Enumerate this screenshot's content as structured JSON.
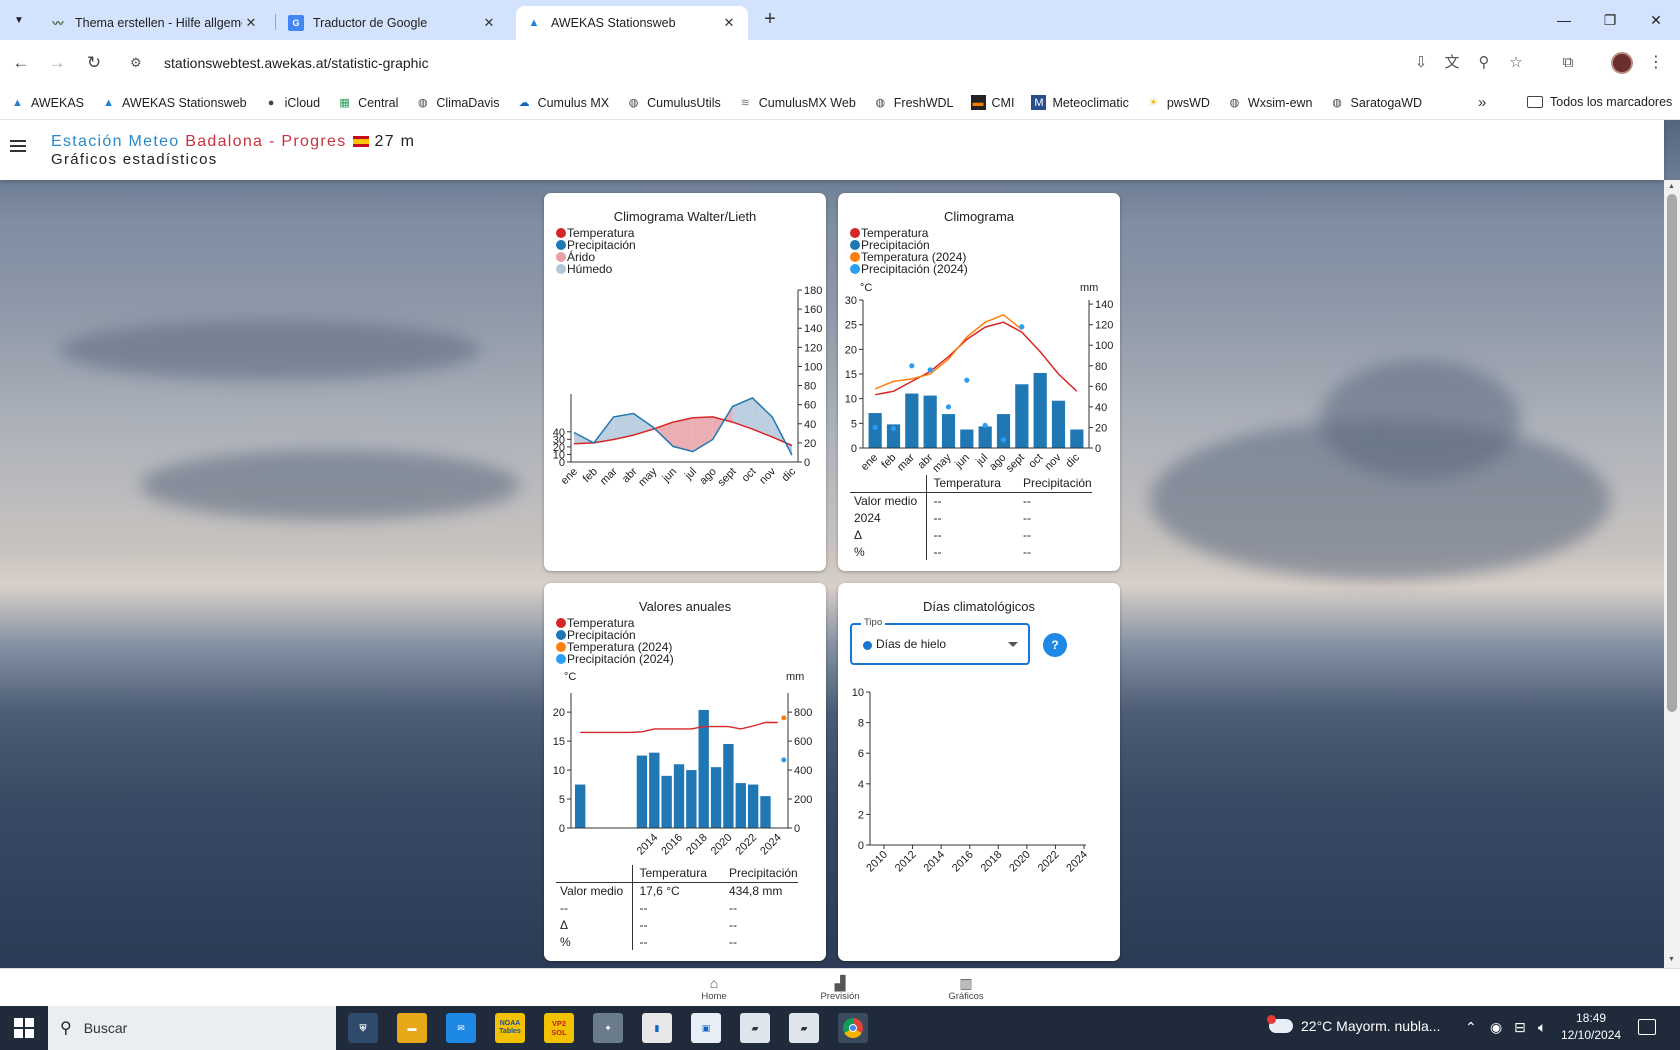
{
  "browser": {
    "tabs": [
      {
        "title": "Thema erstellen - Hilfe allgeme",
        "icon": "wxforum-icon",
        "active": false
      },
      {
        "title": "Traductor de Google",
        "icon": "google-translate-icon",
        "active": false
      },
      {
        "title": "AWEKAS Stationsweb",
        "icon": "awekas-icon",
        "active": true
      }
    ],
    "url": "stationswebtest.awekas.at/statistic-graphic",
    "bookmarks": [
      "AWEKAS",
      "AWEKAS Stationsweb",
      "iCloud",
      "Central",
      "ClimaDavis",
      "Cumulus MX",
      "CumulusUtils",
      "CumulusMX Web",
      "FreshWDL",
      "CMI",
      "Meteoclimatic",
      "pwsWD",
      "Wxsim-ewn",
      "SaratogaWD"
    ],
    "all_bookmarks": "Todos los marcadores",
    "overflow": "»"
  },
  "header": {
    "title_part1": "Estación Meteo",
    "title_part2": "Badalona - Progres",
    "altitude": "27 m",
    "subtitle": "Gráficos estadísticos"
  },
  "colors": {
    "temperature": "#d62728",
    "precipitation": "#1f77b4",
    "temperature_year": "#ff7f0e",
    "precipitation_year": "#2a9df4",
    "arid": "#e8a0a4",
    "humid": "#b0c8dc"
  },
  "walter": {
    "title": "Climograma Walter/Lieth",
    "legend": [
      "Temperatura",
      "Precipitación",
      "Árido",
      "Húmedo"
    ]
  },
  "climograma": {
    "title": "Climograma",
    "legend": [
      "Temperatura",
      "Precipitación",
      "Temperatura (2024)",
      "Precipitación (2024)"
    ],
    "y_left_unit": "°C",
    "y_right_unit": "mm",
    "table": {
      "headers": [
        "",
        "Temperatura",
        "Precipitación"
      ],
      "rows": [
        [
          "Valor medio",
          "--",
          "--"
        ],
        [
          "2024",
          "--",
          "--"
        ],
        [
          "Δ",
          "--",
          "--"
        ],
        [
          "%",
          "--",
          "--"
        ]
      ]
    }
  },
  "anuales": {
    "title": "Valores anuales",
    "legend": [
      "Temperatura",
      "Precipitación",
      "Temperatura (2024)",
      "Precipitación (2024)"
    ],
    "y_left_unit": "°C",
    "y_right_unit": "mm",
    "table": {
      "headers": [
        "",
        "Temperatura",
        "Precipitación"
      ],
      "rows": [
        [
          "Valor medio",
          "17,6 °C",
          "434,8 mm"
        ],
        [
          "--",
          "--",
          "--"
        ],
        [
          "Δ",
          "--",
          "--"
        ],
        [
          "%",
          "--",
          "--"
        ]
      ]
    }
  },
  "dias": {
    "title": "Días climatológicos",
    "select_label": "Tipo",
    "select_value": "Días de hielo",
    "help": "?"
  },
  "chart_data": [
    {
      "type": "area",
      "name": "walter",
      "categories": [
        "ene",
        "feb",
        "mar",
        "abr",
        "may",
        "jun",
        "jul",
        "ago",
        "sept",
        "oct",
        "nov",
        "dic"
      ],
      "y_left_ticks": [
        0,
        10,
        20,
        30,
        40
      ],
      "y_right_ticks": [
        0,
        20,
        40,
        60,
        80,
        100,
        120,
        140,
        160,
        180
      ],
      "y_left_range": [
        0,
        90
      ],
      "y_right_range": [
        0,
        180
      ],
      "series": [
        {
          "name": "Temperatura",
          "axis": "left",
          "values": [
            10.5,
            11,
            13,
            15.5,
            19,
            23,
            25.5,
            26,
            23,
            19,
            14.5,
            9.5
          ]
        },
        {
          "name": "Precipitación",
          "axis": "right",
          "values": [
            34,
            22,
            52,
            56,
            40,
            18,
            12,
            26,
            64,
            74,
            52,
            8
          ]
        }
      ]
    },
    {
      "type": "bar",
      "name": "climograma",
      "categories": [
        "ene",
        "feb",
        "mar",
        "abr",
        "may",
        "jun",
        "jul",
        "ago",
        "sept",
        "oct",
        "nov",
        "dic"
      ],
      "y_left_ticks": [
        0,
        5,
        10,
        15,
        20,
        25,
        30
      ],
      "y_right_ticks": [
        0,
        20,
        40,
        60,
        80,
        100,
        120,
        140
      ],
      "y_left_range": [
        0,
        30
      ],
      "y_right_range": [
        0,
        144
      ],
      "series": [
        {
          "name": "Temperatura",
          "type": "line",
          "axis": "left",
          "values": [
            10.8,
            11.5,
            13.5,
            15.5,
            18.5,
            22,
            24.5,
            25.5,
            23.5,
            19.5,
            15,
            11.5
          ]
        },
        {
          "name": "Precipitación",
          "type": "bar",
          "axis": "right",
          "values": [
            34,
            23,
            53,
            51,
            33,
            18,
            21,
            33,
            62,
            73,
            46,
            18
          ]
        },
        {
          "name": "Temperatura (2024)",
          "type": "line",
          "axis": "left",
          "values": [
            12,
            13.5,
            14,
            15,
            18,
            22.5,
            25.5,
            27,
            24,
            null,
            null,
            null
          ]
        },
        {
          "name": "Precipitación (2024)",
          "type": "scatter",
          "axis": "right",
          "values": [
            20,
            19,
            80,
            76,
            40,
            66,
            22,
            8,
            118,
            null,
            null,
            null
          ]
        }
      ]
    },
    {
      "type": "bar",
      "name": "anuales",
      "x": [
        2008,
        2009,
        2010,
        2011,
        2012,
        2013,
        2014,
        2015,
        2016,
        2017,
        2018,
        2019,
        2020,
        2021,
        2022,
        2023,
        2024
      ],
      "x_tick_labels": [
        "2014",
        "2016",
        "2018",
        "2020",
        "2022",
        "2024"
      ],
      "y_left_ticks": [
        0,
        5,
        10,
        15,
        20
      ],
      "y_right_ticks": [
        0,
        200,
        400,
        600,
        800
      ],
      "y_left_range": [
        0,
        23.3
      ],
      "y_right_range": [
        0,
        932
      ],
      "series": [
        {
          "name": "Precipitación",
          "type": "bar",
          "axis": "right",
          "values": [
            300,
            null,
            null,
            null,
            null,
            500,
            520,
            360,
            440,
            400,
            815,
            420,
            580,
            310,
            300,
            220,
            null
          ]
        },
        {
          "name": "Temperatura",
          "type": "line",
          "axis": "left",
          "values": [
            16.5,
            16.5,
            16.5,
            16.5,
            16.5,
            16.6,
            17.1,
            17.1,
            17.1,
            17.1,
            17.5,
            17.5,
            17.5,
            17.1,
            17.6,
            18.2,
            18.2
          ]
        },
        {
          "name": "Temperatura (2024)",
          "type": "scatter",
          "axis": "left",
          "values": [
            null,
            null,
            null,
            null,
            null,
            null,
            null,
            null,
            null,
            null,
            null,
            null,
            null,
            null,
            null,
            null,
            19
          ]
        },
        {
          "name": "Precipitación (2024)",
          "type": "scatter",
          "axis": "right",
          "values": [
            null,
            null,
            null,
            null,
            null,
            null,
            null,
            null,
            null,
            null,
            null,
            null,
            null,
            null,
            null,
            null,
            470
          ]
        }
      ]
    },
    {
      "type": "bar",
      "name": "dias",
      "x_tick_labels": [
        "2010",
        "2012",
        "2014",
        "2016",
        "2018",
        "2020",
        "2022",
        "2024"
      ],
      "y_ticks": [
        0,
        2,
        4,
        6,
        8,
        10
      ],
      "ylim": [
        0,
        10
      ],
      "values": []
    }
  ],
  "bottom_nav": [
    "Home",
    "Previsión",
    "Gráficos"
  ],
  "taskbar": {
    "search_placeholder": "Buscar",
    "weather": "22°C  Mayorm. nubla...",
    "time": "18:49",
    "date": "12/10/2024",
    "apps": [
      "mcafee-icon",
      "file-explorer-icon",
      "mail-icon",
      "noaa-tables-icon",
      "vp2-sol-icon",
      "app-icon",
      "app-icon",
      "app-icon",
      "folder-icon",
      "folder-icon",
      "chrome-icon"
    ],
    "app_labels": {
      "noaa": "NOAA Tables",
      "vp2": "VP2 SOL"
    }
  }
}
